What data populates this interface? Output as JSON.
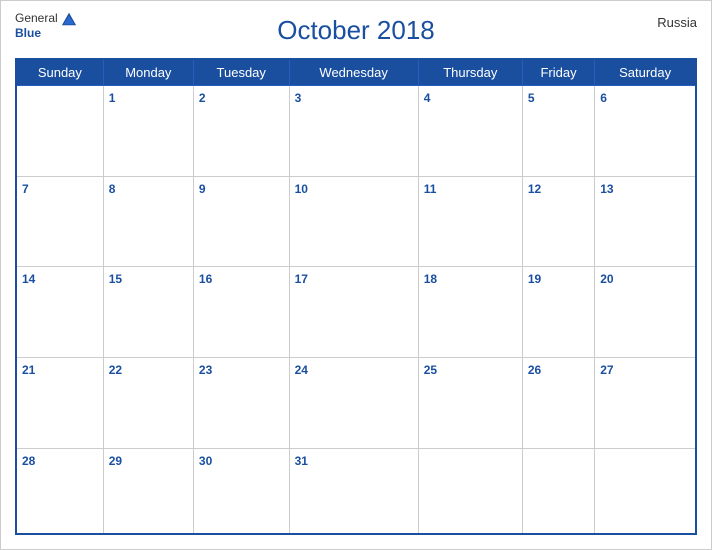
{
  "header": {
    "logo_general": "General",
    "logo_blue": "Blue",
    "title": "October 2018",
    "country": "Russia"
  },
  "weekdays": [
    "Sunday",
    "Monday",
    "Tuesday",
    "Wednesday",
    "Thursday",
    "Friday",
    "Saturday"
  ],
  "weeks": [
    [
      "",
      "1",
      "2",
      "3",
      "4",
      "5",
      "6"
    ],
    [
      "7",
      "8",
      "9",
      "10",
      "11",
      "12",
      "13"
    ],
    [
      "14",
      "15",
      "16",
      "17",
      "18",
      "19",
      "20"
    ],
    [
      "21",
      "22",
      "23",
      "24",
      "25",
      "26",
      "27"
    ],
    [
      "28",
      "29",
      "30",
      "31",
      "",
      "",
      ""
    ]
  ]
}
